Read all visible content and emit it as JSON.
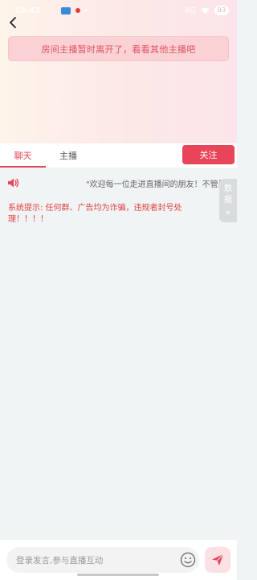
{
  "status_bar": {
    "time": "19:43",
    "dot": "•",
    "signal": "4G",
    "battery": "93"
  },
  "notice": {
    "text": "房间主播暂时离开了，看看其他主播吧"
  },
  "tabs": [
    {
      "label": "聊天",
      "active": true
    },
    {
      "label": "主播",
      "active": false
    }
  ],
  "follow_button": {
    "label": "关注"
  },
  "chat": {
    "marquee": "\"欢迎每一位走进直播间的朋友！不管是老朋友",
    "system_tip": "系统提示: 任何群、广告均为诈骗，违规者封号处理！！！！"
  },
  "side_tab": {
    "chars": [
      "数",
      "据"
    ],
    "chevron": "«"
  },
  "input": {
    "placeholder": "登录发言,参与直播互动"
  },
  "icons": {
    "back": "chevron-left-icon",
    "speaker": "speaker-icon",
    "emoji": "smiley-icon",
    "send": "send-icon"
  },
  "colors": {
    "accent": "#e8455a",
    "notice_bg": "#fad1d4",
    "system_tip": "#e2413f",
    "chat_bg": "#f0f4f5"
  }
}
